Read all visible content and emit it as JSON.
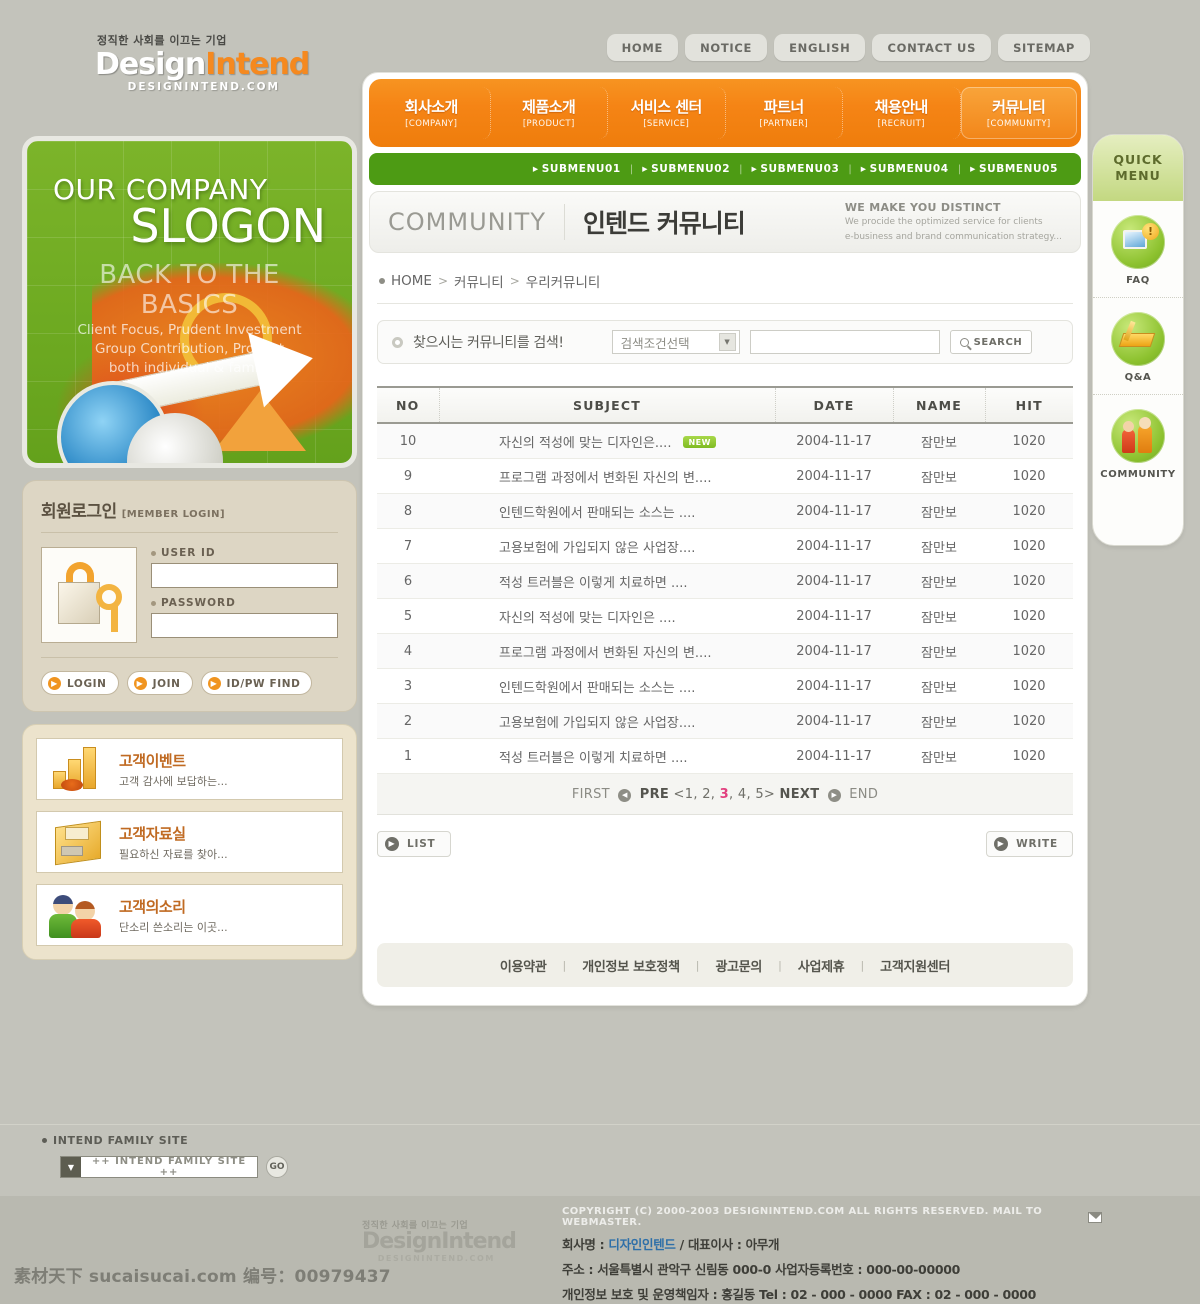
{
  "header": {
    "logo": {
      "tagline": "정직한 사회를 이끄는 기업",
      "name_w": "Design",
      "name_o": "Intend",
      "url": "DESIGNINTEND.COM"
    },
    "topnav": [
      "HOME",
      "NOTICE",
      "ENGLISH",
      "CONTACT US",
      "SITEMAP"
    ]
  },
  "gnb": [
    {
      "kr": "회사소개",
      "en": "[COMPANY]"
    },
    {
      "kr": "제품소개",
      "en": "[PRODUCT]"
    },
    {
      "kr": "서비스 센터",
      "en": "[SERVICE]"
    },
    {
      "kr": "파트너",
      "en": "[PARTNER]"
    },
    {
      "kr": "채용안내",
      "en": "[RECRUIT]"
    },
    {
      "kr": "커뮤니티",
      "en": "[COMMUNITY]"
    }
  ],
  "snb": [
    "SUBMENU01",
    "SUBMENU02",
    "SUBMENU03",
    "SUBMENU04",
    "SUBMENU05"
  ],
  "page_title": {
    "en": "COMMUNITY",
    "kr": "인텐드 커뮤니티",
    "slogan_head": "WE MAKE YOU DISTINCT",
    "slogan_line1": "We procide the optimized service for clients",
    "slogan_line2": "e-business and brand communication strategy..."
  },
  "breadcrumb": {
    "home": "HOME",
    "level1": "커뮤니티",
    "level2": "우리커뮤니티",
    "sep": ">"
  },
  "search": {
    "label": "찾으시는 커뮤니티를 검색!",
    "select_value": "검색조건선택",
    "input_value": "",
    "button": "SEARCH"
  },
  "board": {
    "columns": [
      "NO",
      "SUBJECT",
      "DATE",
      "NAME",
      "HIT"
    ],
    "new_badge": "NEW",
    "rows": [
      {
        "no": "10",
        "subject": "자신의 적성에 맞는 디자인은....",
        "is_new": true,
        "date": "2004-11-17",
        "name": "잠만보",
        "hit": "1020"
      },
      {
        "no": "9",
        "subject": "프로그램 과정에서 변화된 자신의 변....",
        "is_new": false,
        "date": "2004-11-17",
        "name": "잠만보",
        "hit": "1020"
      },
      {
        "no": "8",
        "subject": "인텐드학원에서 판매되는 소스는 ....",
        "is_new": false,
        "date": "2004-11-17",
        "name": "잠만보",
        "hit": "1020"
      },
      {
        "no": "7",
        "subject": "고용보험에 가입되지 않은 사업장....",
        "is_new": false,
        "date": "2004-11-17",
        "name": "잠만보",
        "hit": "1020"
      },
      {
        "no": "6",
        "subject": "적성 트러블은 이렇게 치료하면 ....",
        "is_new": false,
        "date": "2004-11-17",
        "name": "잠만보",
        "hit": "1020"
      },
      {
        "no": "5",
        "subject": "자신의 적성에 맞는 디자인은 ....",
        "is_new": false,
        "date": "2004-11-17",
        "name": "잠만보",
        "hit": "1020"
      },
      {
        "no": "4",
        "subject": "프로그램 과정에서 변화된 자신의 변....",
        "is_new": false,
        "date": "2004-11-17",
        "name": "잠만보",
        "hit": "1020"
      },
      {
        "no": "3",
        "subject": "인텐드학원에서 판매되는 소스는 ....",
        "is_new": false,
        "date": "2004-11-17",
        "name": "잠만보",
        "hit": "1020"
      },
      {
        "no": "2",
        "subject": "고용보험에 가입되지 않은 사업장....",
        "is_new": false,
        "date": "2004-11-17",
        "name": "잠만보",
        "hit": "1020"
      },
      {
        "no": "1",
        "subject": "적성 트러블은 이렇게 치료하면 ....",
        "is_new": false,
        "date": "2004-11-17",
        "name": "잠만보",
        "hit": "1020"
      }
    ]
  },
  "pager": {
    "first": "FIRST",
    "pre": "PRE",
    "next": "NEXT",
    "end": "END",
    "open": "<",
    "close": ">",
    "pages": [
      "1",
      "2",
      "3",
      "4",
      "5"
    ],
    "current": "3",
    "current_color": "#e2407f"
  },
  "actions": {
    "list": "LIST",
    "write": "WRITE"
  },
  "slogan_banner": {
    "line1": "OUR COMPANY",
    "line2": "SLOGON",
    "line3": "BACK TO THE BASICS",
    "line4": "Client Focus, Prudent Investment",
    "line5": "Group Contribution, Product",
    "line6": "both individual & family"
  },
  "login": {
    "title_kr": "회원로그인",
    "title_en": "[MEMBER LOGIN]",
    "userid_label": "USER ID",
    "password_label": "PASSWORD",
    "userid_value": "",
    "password_value": "",
    "buttons": [
      "LOGIN",
      "JOIN",
      "ID/PW FIND"
    ]
  },
  "banners": [
    {
      "title": "고객이벤트",
      "sub": "고객 감사에 보답하는...",
      "icon": "gift-chart-icon"
    },
    {
      "title": "고객자료실",
      "sub": "필요하신 자료를 찾아...",
      "icon": "floppy-disk-icon"
    },
    {
      "title": "고객의소리",
      "sub": "단소리 쓴소리는 이곳...",
      "icon": "people-icon"
    }
  ],
  "quick_menu": {
    "title_line1": "QUICK",
    "title_line2": "MENU",
    "items": [
      {
        "label": "FAQ",
        "icon": "monitor-question-icon"
      },
      {
        "label": "Q&A",
        "icon": "book-pen-icon"
      },
      {
        "label": "COMMUNITY",
        "icon": "people-group-icon"
      }
    ]
  },
  "footer_links": [
    "이용약관",
    "개인정보 보호정책",
    "광고문의",
    "사업제휴",
    "고객지원센터"
  ],
  "family_site": {
    "title": "INTEND FAMILY SITE",
    "select_value": "++ INTEND FAMILY SITE ++",
    "go": "GO"
  },
  "copyright": {
    "line1": "COPYRIGHT (C) 2000-2003 DESIGNINTEND.COM  ALL RIGHTS RESERVED. MAIL TO WEBMASTER.",
    "company_label": "회사명 : ",
    "company_name": "디자인인텐드",
    "company_rest": " / 대표이사 : 아무개",
    "address": "주소 : 서울특별시 관악구 신림동 000-0  사업자등록번호 : 000-00-00000",
    "manager": "개인정보 보호 및 운영책임자 :  홍길동  Tel : 02 - 000 - 0000  FAX : 02 - 000 - 0000"
  },
  "watermark": "素材天下 sucaisucai.com  编号：00979437"
}
